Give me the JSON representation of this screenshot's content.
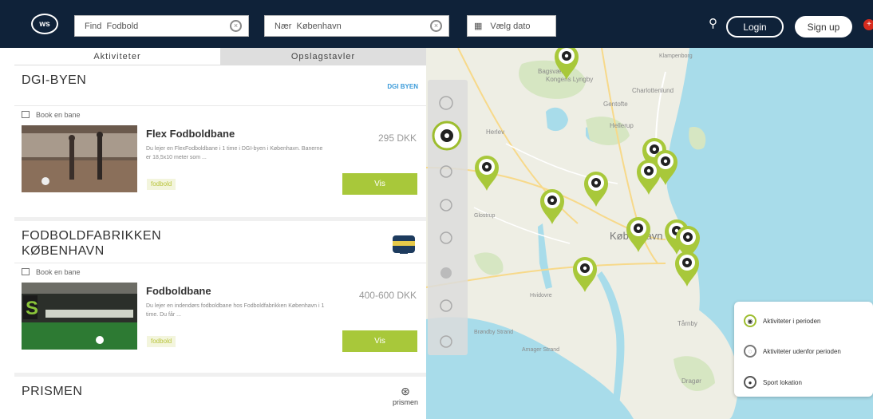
{
  "header": {
    "logo": "ws",
    "search_value": "Find  Fodbold",
    "near_value": "Nær  København",
    "date_value": "Vælg dato",
    "login": "Login",
    "signup": "Sign up"
  },
  "tabs": [
    "Aktiviteter",
    "Opslagstavler"
  ],
  "venues": [
    {
      "name": "DGI-BYEN",
      "logo_text": "DGI BYEN",
      "book_label": "Book en bane",
      "activity": {
        "title": "Flex Fodboldbane",
        "desc": "Du lejer en FlexFodboldbane i 1 time i DGI-byen i København. Banerne er 18,5x10 meter som ...",
        "tag": "fodbold",
        "price": "295 DKK",
        "button": "Vis"
      }
    },
    {
      "name_line1": "FODBOLDFABRIKKEN",
      "name_line2": "KØBENHAVN",
      "book_label": "Book en bane",
      "activity": {
        "title": "Fodboldbane",
        "desc": "Du lejer en indendørs fodboldbane hos Fodboldfabrikken København i 1 time. Du får ...",
        "tag": "fodbold",
        "price": "400-600 DKK",
        "button": "Vis"
      }
    },
    {
      "name": "PRISMEN",
      "logo_text": "prismen"
    }
  ],
  "map": {
    "labels": {
      "lyngby": "Kongens Lyngby",
      "kbh": "København",
      "herlev": "Herlev",
      "hellerup": "Hellerup",
      "charlottenlund": "Charlottenlund",
      "tarnby": "Tårnby",
      "hvidovre": "Hvidovre",
      "amager": "Amager Strand",
      "brondby": "Brøndby Strand",
      "dragor": "Dragør",
      "klampenborg": "Klampenborg",
      "bagsvaerd": "Bagsværd",
      "gentofte": "Gentofte",
      "glostrup": "Glostrup"
    }
  },
  "legend": {
    "items": [
      "Aktiviteter i perioden",
      "Aktiviteter udenfor perioden",
      "Sport lokation"
    ]
  },
  "colors": {
    "topbar": "#0f2239",
    "accent": "#a8c83a",
    "water": "#a8dcea",
    "land": "#eeeee4"
  }
}
